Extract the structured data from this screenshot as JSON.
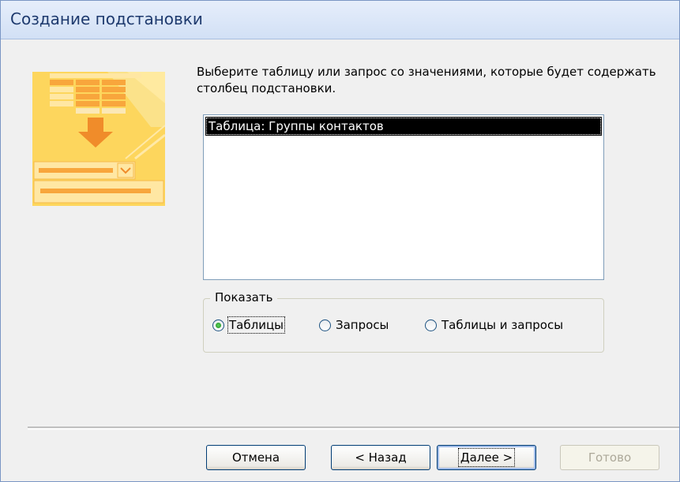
{
  "window": {
    "title": "Создание подстановки"
  },
  "prompt": "Выберите таблицу или запрос со значениями, которые будет содержать столбец подстановки.",
  "list": {
    "items": [
      "Таблица: Группы контактов"
    ],
    "selected_index": 0
  },
  "show_group": {
    "label": "Показать",
    "options": [
      {
        "label": "Таблицы",
        "checked": true
      },
      {
        "label": "Запросы",
        "checked": false
      },
      {
        "label": "Таблицы и запросы",
        "checked": false
      }
    ]
  },
  "buttons": {
    "cancel": "Отмена",
    "back": "< Назад",
    "next": "Далее >",
    "finish": "Готово"
  },
  "colors": {
    "title_text": "#1e3a6e",
    "selection": "#000000",
    "illustration_bg": "#fdd65d",
    "radio_dot": "#1e8b1e"
  },
  "icons": {
    "illustration": "lookup-wizard-illustration-icon"
  }
}
